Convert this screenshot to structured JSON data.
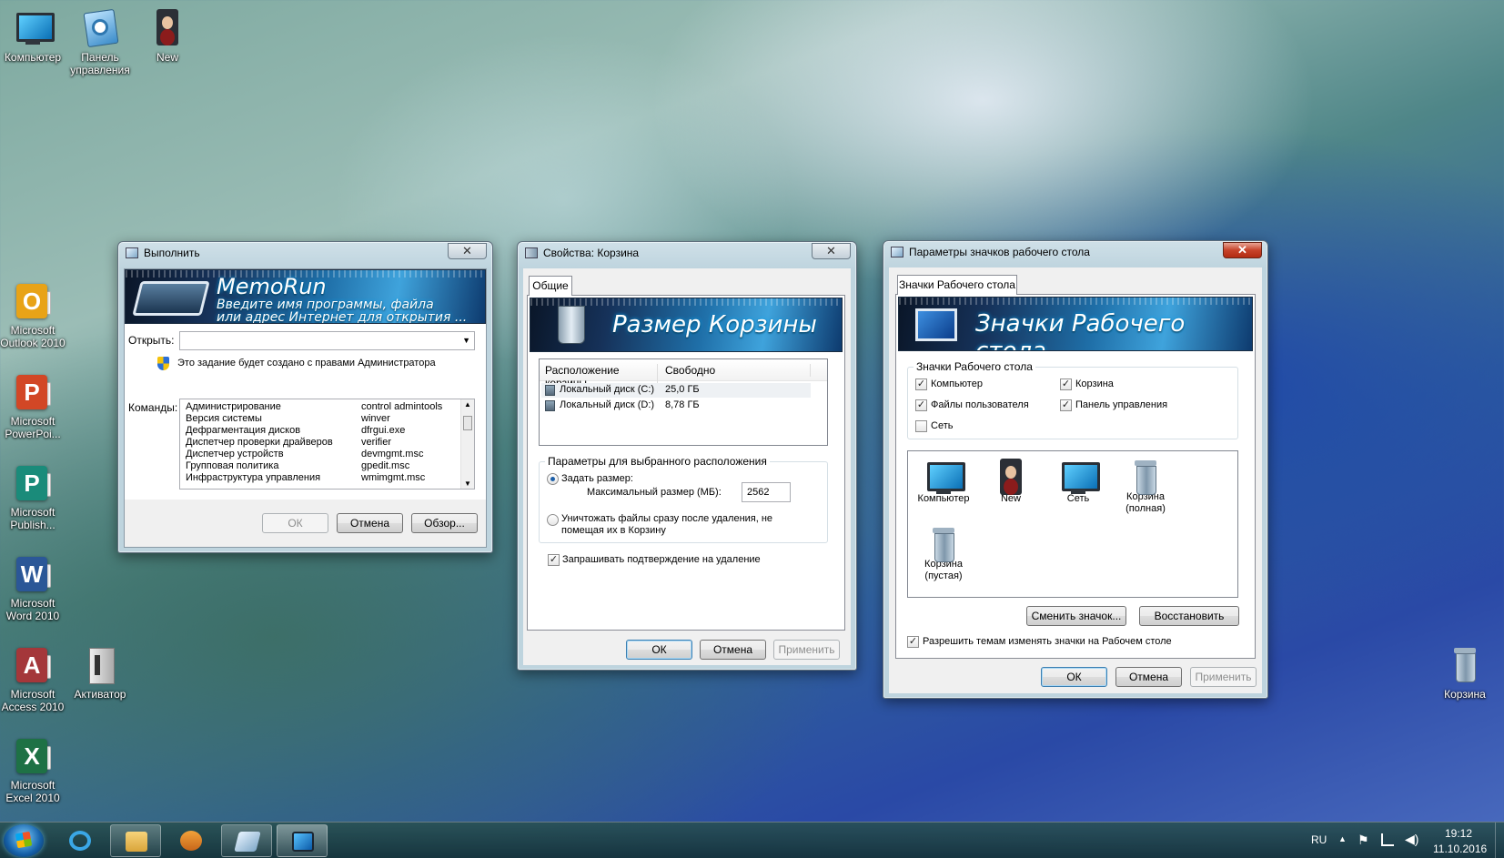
{
  "desktop": {
    "icons": [
      {
        "label": "Компьютер"
      },
      {
        "label": "Панель управления"
      },
      {
        "label": "New"
      },
      {
        "label": "Microsoft Outlook 2010"
      },
      {
        "label": "Microsoft PowerPoi..."
      },
      {
        "label": "Microsoft Publish..."
      },
      {
        "label": "Microsoft Word 2010"
      },
      {
        "label": "Microsoft Access 2010"
      },
      {
        "label": "Активатор"
      },
      {
        "label": "Microsoft Excel 2010"
      },
      {
        "label": "Корзина"
      }
    ]
  },
  "run_dialog": {
    "title": "Выполнить",
    "close": "✕",
    "banner_title": "MemoRun",
    "banner_line1": "Введите имя программы, файла",
    "banner_line2": "или адрес Интернет для открытия ...",
    "open_label": "Открыть:",
    "open_value": "",
    "admin_note": "Это задание будет создано с правами Администратора",
    "commands_label": "Команды:",
    "commands": [
      {
        "name": "Администрирование",
        "cmd": "control admintools"
      },
      {
        "name": "Версия системы",
        "cmd": "winver"
      },
      {
        "name": "Дефрагментация дисков",
        "cmd": "dfrgui.exe"
      },
      {
        "name": "Диспетчер проверки драйверов",
        "cmd": "verifier"
      },
      {
        "name": "Диспетчер устройств",
        "cmd": "devmgmt.msc"
      },
      {
        "name": "Групповая политика",
        "cmd": "gpedit.msc"
      },
      {
        "name": "Инфраструктура управления",
        "cmd": "wmimgmt.msc"
      }
    ],
    "ok": "ОК",
    "cancel": "Отмена",
    "browse": "Обзор..."
  },
  "bin_props": {
    "title": "Свойства: Корзина",
    "close": "✕",
    "tab": "Общие",
    "banner_title": "Размер Корзины",
    "col_location": "Расположение корзины",
    "col_free": "Свободно",
    "drives": [
      {
        "name": "Локальный диск (C:)",
        "free": "25,0 ГБ"
      },
      {
        "name": "Локальный диск (D:)",
        "free": "8,78 ГБ"
      }
    ],
    "group_title": "Параметры для выбранного расположения",
    "set_size_label": "Задать размер:",
    "max_size_label": "Максимальный размер (МБ):",
    "max_size_value": "2562",
    "destroy_label_1": "Уничтожать файлы сразу после удаления, не",
    "destroy_label_2": "помещая их в Корзину",
    "confirm_label": "Запрашивать подтверждение на удаление",
    "ok": "ОК",
    "cancel": "Отмена",
    "apply": "Применить"
  },
  "icon_params": {
    "title": "Параметры значков рабочего стола",
    "close": "✕",
    "tab": "Значки Рабочего стола",
    "banner_title": "Значки Рабочего стола",
    "group_title": "Значки Рабочего стола",
    "checks": {
      "computer": "Компьютер",
      "recycle": "Корзина",
      "user_files": "Файлы пользователя",
      "control_panel": "Панель управления",
      "network": "Сеть"
    },
    "icons": [
      {
        "label": "Компьютер"
      },
      {
        "label": "New"
      },
      {
        "label": "Сеть"
      },
      {
        "label": "Корзина (полная)"
      },
      {
        "label": "Корзина (пустая)"
      }
    ],
    "change_icon": "Сменить значок...",
    "restore": "Восстановить",
    "allow_themes": "Разрешить темам изменять значки на Рабочем столе",
    "ok": "ОК",
    "cancel": "Отмена",
    "apply": "Применить"
  },
  "taskbar": {
    "lang": "RU",
    "time": "19:12",
    "date": "11.10.2016"
  }
}
